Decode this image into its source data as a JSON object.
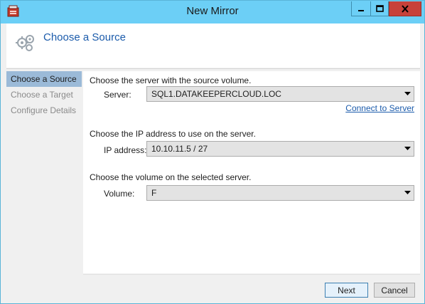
{
  "window": {
    "title": "New Mirror",
    "icon": "datakeeper-app-icon"
  },
  "header": {
    "title": "Choose a Source",
    "icon": "wizard-gears-icon"
  },
  "sidebar": {
    "items": [
      {
        "label": "Choose a Source",
        "active": true
      },
      {
        "label": "Choose a Target",
        "active": false
      },
      {
        "label": "Configure Details",
        "active": false
      }
    ]
  },
  "form": {
    "server_prompt": "Choose the server with the source volume.",
    "server_label": "Server:",
    "server_value": "SQL1.DATAKEEPERCLOUD.LOC",
    "connect_link": "Connect to Server",
    "ip_prompt": "Choose the IP address to use on the server.",
    "ip_label": "IP address:",
    "ip_value": "10.10.11.5 / 27",
    "volume_prompt": "Choose the volume on the selected server.",
    "volume_label": "Volume:",
    "volume_value": "F"
  },
  "buttons": {
    "next": "Next",
    "cancel": "Cancel"
  },
  "colors": {
    "titlebar": "#6ccff6",
    "close": "#c7413a",
    "accent_text": "#1b5bab",
    "sidebar_active": "#9bbad8"
  }
}
